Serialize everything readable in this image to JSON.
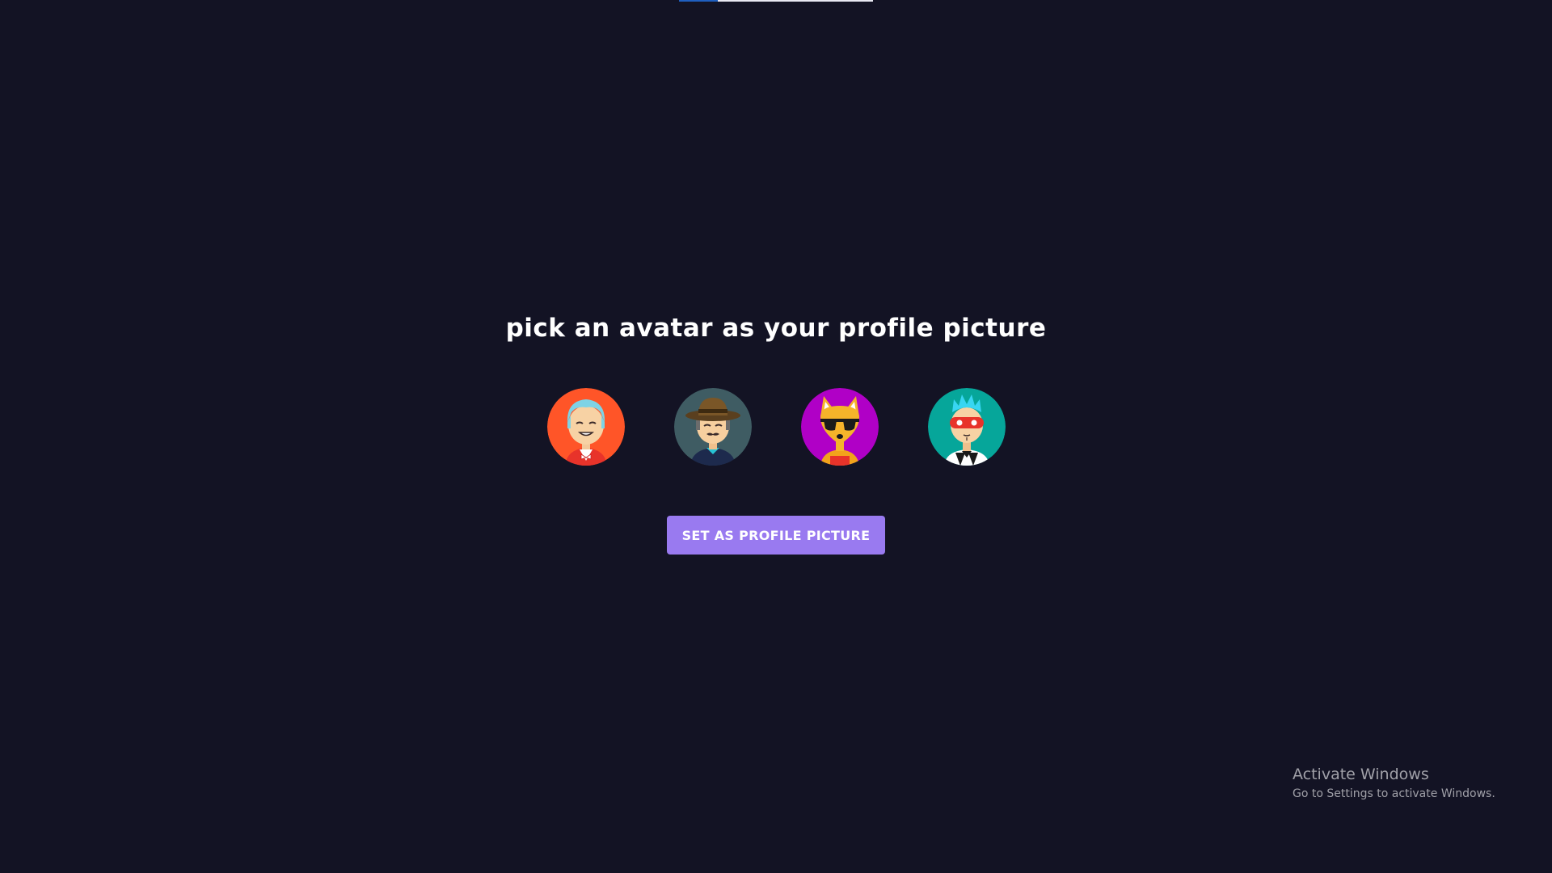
{
  "top_progress": {
    "fill_fraction": 0.2,
    "colors": {
      "track": "#e9e9f2",
      "fill": "#1f5fbf"
    }
  },
  "main": {
    "title": "pick an avatar as your profile picture",
    "avatars": [
      {
        "label": "Avatar with blue hair on orange background",
        "icon": "avatar-blue-hair-icon",
        "background": "#ff5528"
      },
      {
        "label": "Avatar with fedora hat on slate background",
        "icon": "avatar-fedora-icon",
        "background": "#3f5c63"
      },
      {
        "label": "Fox avatar with sunglasses on purple background",
        "icon": "avatar-fox-sunglasses-icon",
        "background": "#b000c6"
      },
      {
        "label": "Avatar with red mask on teal background",
        "icon": "avatar-masked-icon",
        "background": "#06a69a"
      }
    ],
    "set_button_label": "Set as Profile Picture"
  },
  "watermark": {
    "title": "Activate Windows",
    "subtitle": "Go to Settings to activate Windows."
  },
  "colors": {
    "background": "#131324",
    "button": "#997af0",
    "text": "#ffffff"
  }
}
